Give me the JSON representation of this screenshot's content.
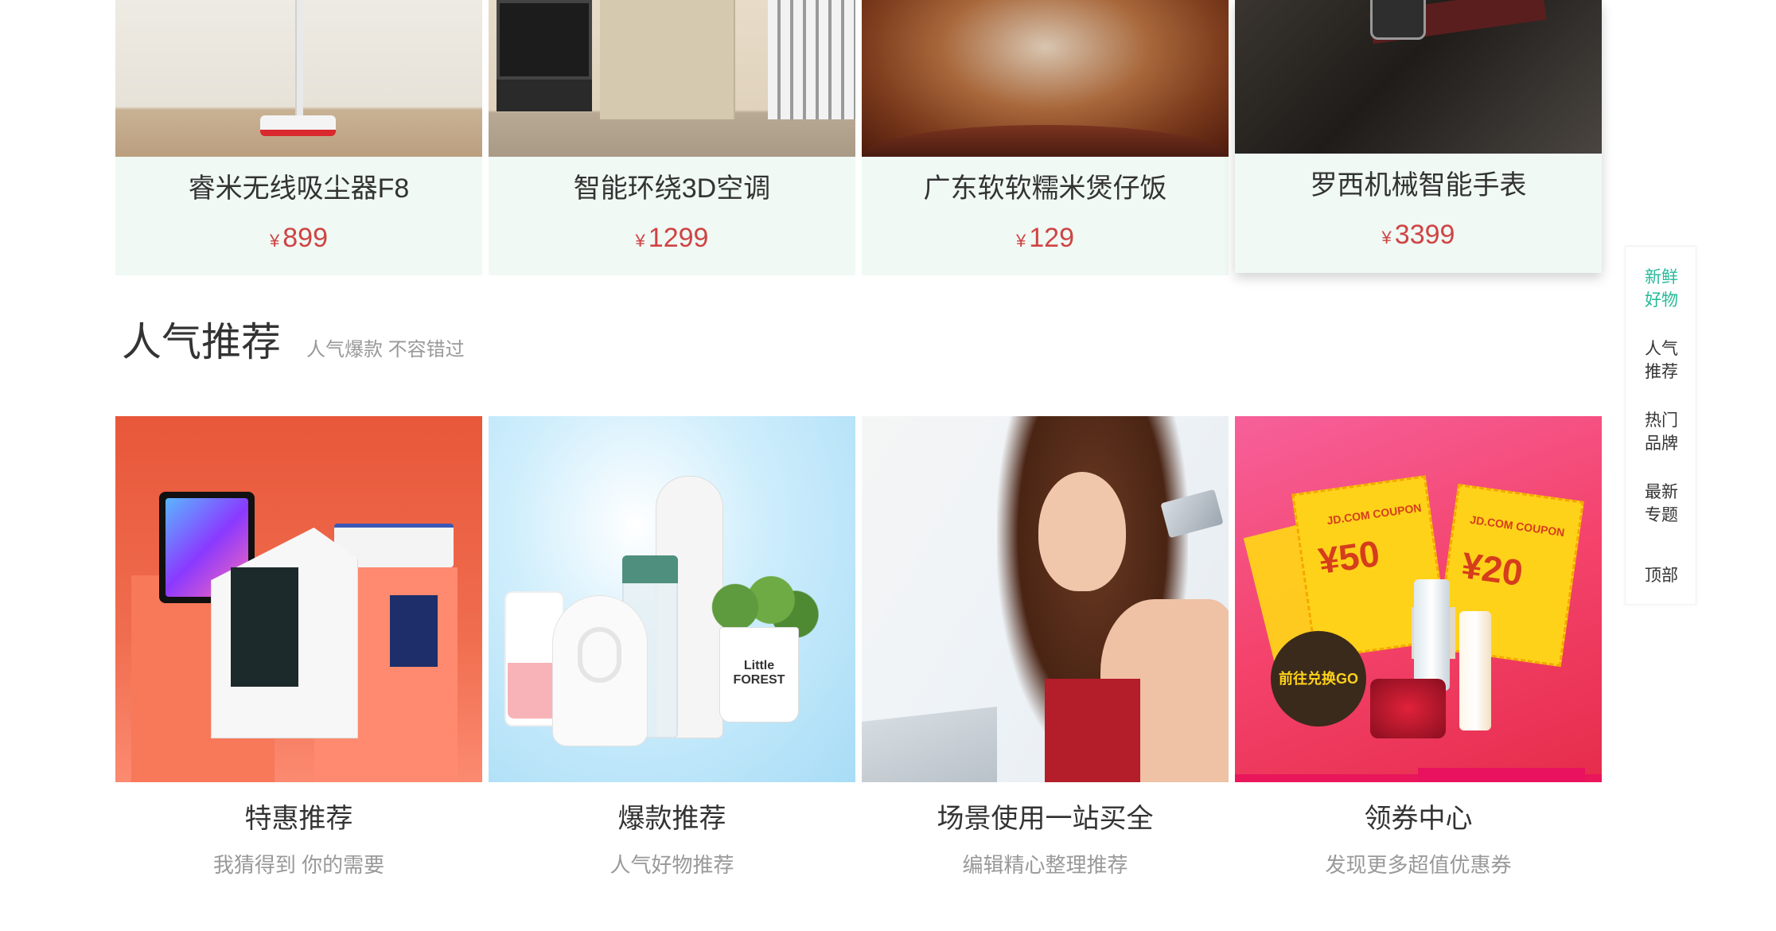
{
  "fresh": {
    "items": [
      {
        "name": "睿米无线吸尘器F8",
        "currency": "¥",
        "price": "899",
        "icon": "vacuum-cleaner-image"
      },
      {
        "name": "智能环绕3D空调",
        "currency": "¥",
        "price": "1299",
        "icon": "kitchen-appliance-image"
      },
      {
        "name": "广东软软糯米煲仔饭",
        "currency": "¥",
        "price": "129",
        "icon": "claypot-rice-image"
      },
      {
        "name": "罗西机械智能手表",
        "currency": "¥",
        "price": "3399",
        "icon": "smart-watch-image"
      }
    ]
  },
  "popular": {
    "title": "人气推荐",
    "subtitle": "人气爆款 不容错过",
    "items": [
      {
        "name": "特惠推荐",
        "desc": "我猜得到 你的需要",
        "icon": "electronics-image"
      },
      {
        "name": "爆款推荐",
        "desc": "人气好物推荐",
        "icon": "home-goods-image",
        "pot_text": "Little FOREST"
      },
      {
        "name": "场景使用一站买全",
        "desc": "编辑精心整理推荐",
        "icon": "shopping-woman-image"
      },
      {
        "name": "领券中心",
        "desc": "发现更多超值优惠券",
        "icon": "coupon-image",
        "coupon_a": "¥50",
        "coupon_b": "¥20",
        "coupon_brand": "JD.COM COUPON",
        "go_text": "前往兑换GO"
      }
    ]
  },
  "side_nav": {
    "items": [
      {
        "line1": "新鲜",
        "line2": "好物",
        "active": true
      },
      {
        "line1": "人气",
        "line2": "推荐",
        "active": false
      },
      {
        "line1": "热门",
        "line2": "品牌",
        "active": false
      },
      {
        "line1": "最新",
        "line2": "专题",
        "active": false
      }
    ],
    "top_label": "顶部",
    "active_color": "#27ba9b"
  },
  "colors": {
    "price": "#cf4444",
    "card_bg": "#f0f9f4"
  }
}
